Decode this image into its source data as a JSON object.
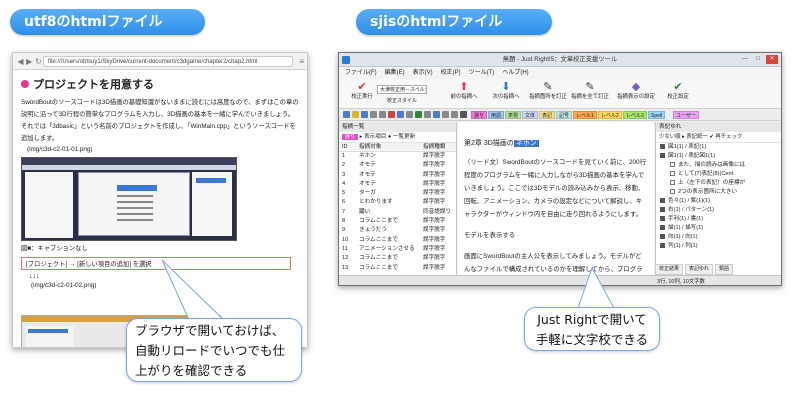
{
  "labels": {
    "left_pill": "utf8のhtmlファイルは……",
    "right_pill": "sjisのhtmlファイルは……",
    "left_callout": [
      "ブラウザで開いておけば、",
      "自動リロードでいつでも仕",
      "上がりを確認できる"
    ],
    "right_callout": [
      "Just Rightで開いて",
      "手軽に文字校できる"
    ]
  },
  "browser": {
    "url": "file:///Users/ohtsuy1/SkyDrive/current-document/c3dgame/chapter2/chap2.html",
    "heading": "プロジェクトを用意する",
    "para1": "SwordBoutのソースコードは3D描画の基礎知識がないままに読むには高度なので、まずはこの章の説明に沿って3D行程の簡単なプログラムを入力し、3D描画の基本を一緒に学んでいきましょう。それでは「3dbasic」という名前のプロジェクトを作成し、「WinMain.cpp」というソースコードを追加します。",
    "img1": "(img/c3d-c2-01-01.png)",
    "caption": "図■：キャプションなし",
    "menu_path": "[プロジェクト] → [新しい項目の追加] を選択",
    "arrows": "↓↓↓",
    "img2": "(img/c3d-c2-01-02.png)"
  },
  "justright": {
    "title": "無題 - Just Right!5：文章校正支援ツール",
    "menus": [
      "ファイル(F)",
      "編集(E)",
      "表示(V)",
      "校正(P)",
      "ツール(T)",
      "ヘルプ(H)"
    ],
    "ribbon": [
      {
        "label": "校正実行",
        "icon": "✔",
        "color": "#d23a2a"
      },
      {
        "label": "前の指摘へ",
        "icon": "⬆",
        "color": "#d6406a"
      },
      {
        "label": "次の指摘へ",
        "icon": "⬇",
        "color": "#2f7ad6"
      },
      {
        "label": "指摘箇所を訂正",
        "icon": "✎",
        "color": "#333"
      },
      {
        "label": "指摘を全て訂正",
        "icon": "✎",
        "color": "#333"
      },
      {
        "label": "指摘表示の設定",
        "icon": "◆",
        "color": "#7a5cc9"
      },
      {
        "label": "校正設定",
        "icon": "✔",
        "color": "#2a8a3a"
      }
    ],
    "style_select": "大津校正用－スペルチェック",
    "style_label": "校正スタイル",
    "tags": [
      {
        "label": "誤り",
        "bg": "#f07ad8"
      },
      {
        "label": "用語",
        "bg": "#9ac6f4"
      },
      {
        "label": "表現",
        "bg": "#b6e49a"
      },
      {
        "label": "文体",
        "bg": "#c9d8f4"
      },
      {
        "label": "表記",
        "bg": "#f4e08a"
      },
      {
        "label": "記号",
        "bg": "#b8e4dc"
      },
      {
        "label": "レベル1",
        "bg": "#ffa94a"
      },
      {
        "label": "レベル2",
        "bg": "#ffd85a"
      },
      {
        "label": "レベル3",
        "bg": "#a7e86a"
      },
      {
        "label": "Spell",
        "bg": "#9ad4f6"
      },
      {
        "label": "ユーザー",
        "bg": "#e6a4f0"
      }
    ],
    "left_panel": {
      "title": "指摘一覧",
      "mode": "誤り",
      "display": "表示項目",
      "bulk": "一覧更新",
      "headers": [
        "ID",
        "指摘対象",
        "指摘種類"
      ],
      "rows": [
        [
          "1",
          "ネホン",
          "誤字脱字"
        ],
        [
          "2",
          "オモテ",
          "誤字脱字"
        ],
        [
          "3",
          "オモテ",
          "誤字脱字"
        ],
        [
          "4",
          "オモテ",
          "誤字脱字"
        ],
        [
          "5",
          "ターガ",
          "誤字脱字"
        ],
        [
          "6",
          "とわかります",
          "誤字脱字"
        ],
        [
          "7",
          "踊い",
          "同音語誤り"
        ],
        [
          "8",
          "コラムここまで",
          "誤字脱字"
        ],
        [
          "9",
          "きょうだう",
          "誤字脱字"
        ],
        [
          "10",
          "コラムここまで",
          "誤字脱字"
        ],
        [
          "11",
          "アニメーションさせる",
          "誤字脱字"
        ],
        [
          "12",
          "コラムここまで",
          "誤字脱字"
        ],
        [
          "13",
          "コラムここまで",
          "誤字脱字"
        ]
      ]
    },
    "editor": {
      "heading_pre": "第2章 3D描画の",
      "heading_hl": "ネホン",
      "para1": "（リード文）SwordBoutのソースコードを見ていく前に、200行程度のプログラムを一緒に入力しながら3D描画の基本を学んでいきましょう。ここでは3Dモデルの読み込みから表示、移動、回転、アニメーション、カメラの設定などについて解説し、キャラクターがウィンドウ内を自由に走り回れるようにします。",
      "para2": "モデルを表示する",
      "para3": "画面にSwordBoutの主人公を表示してみましょう。モデルがどんなファイルで構成されているのかを理解してから、プログラムを書いて読"
    },
    "right_panel": {
      "title": "表記ゆれ",
      "toolbar": "少ない順 ▸ 表記統一 ✔ 再チェック",
      "rows": [
        {
          "text": "図1(1) / 表記(1)",
          "sub": false
        },
        {
          "text": "図1(1) / 表記図1(1)",
          "sub": false
        },
        {
          "text": "また、描の読みは画像には",
          "sub": true
        },
        {
          "text": "として(7)表記(8)(Cent",
          "sub": true
        },
        {
          "text": "上（左下の表記）の座標が",
          "sub": true
        },
        {
          "text": "2つの表示箇所に大きい",
          "sub": true
        },
        {
          "text": "色々(1) / 紫(1)(1)",
          "sub": false
        },
        {
          "text": "右(1) / パターン(1)",
          "sub": false
        },
        {
          "text": "手利(1) / 書(1)",
          "sub": false
        },
        {
          "text": "描(1) / 描写(1)",
          "sub": false
        },
        {
          "text": "向(1) / 向(1)",
          "sub": false
        },
        {
          "text": "列(1) / 列(1)",
          "sub": false
        }
      ]
    },
    "status_tabs": [
      "校正結果",
      "表記ゆれ",
      "類語"
    ],
    "status": "3行, 10列, 10文字数"
  }
}
